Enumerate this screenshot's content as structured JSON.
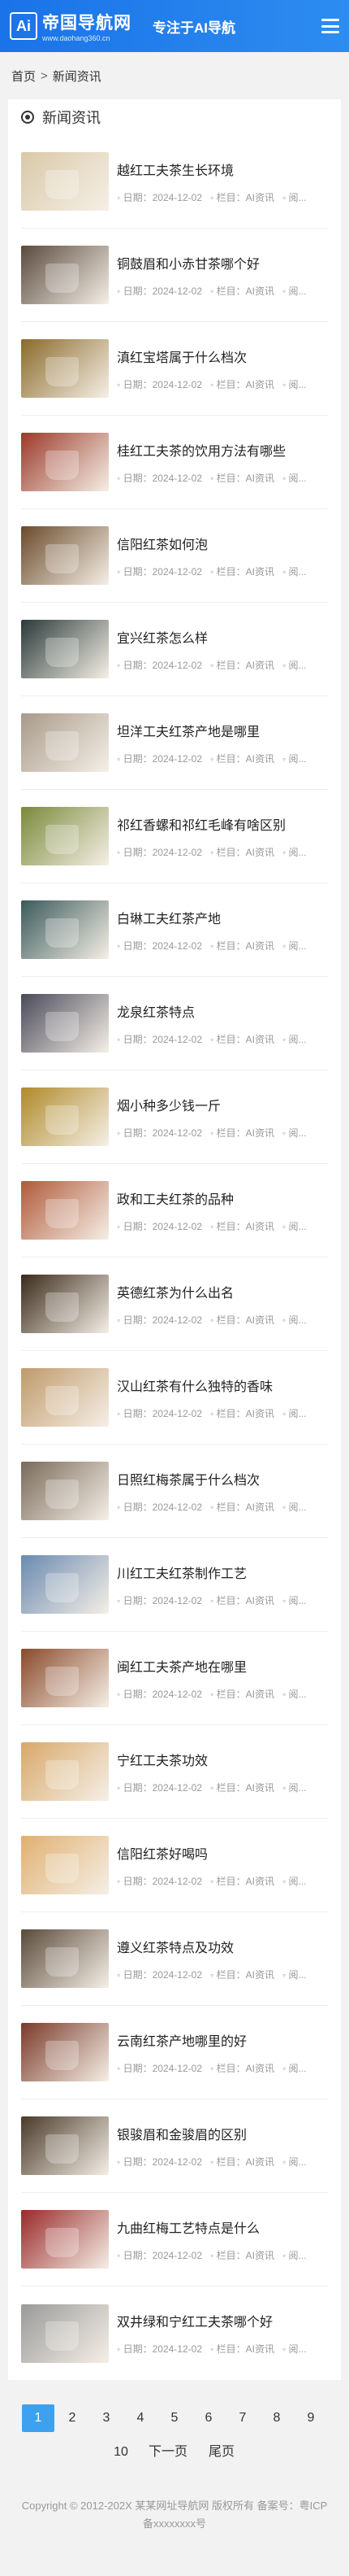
{
  "header": {
    "logo_mark": "Ai",
    "logo_title": "帝国导航网",
    "logo_domain": "www.daohang360.cn",
    "slogan": "专注于AI导航"
  },
  "breadcrumb": {
    "home": "首页",
    "sep": ">",
    "current": "新闻资讯"
  },
  "section_title": "新闻资讯",
  "meta_labels": {
    "date": "日期：",
    "column": "栏目：",
    "views": "阅..."
  },
  "articles": [
    {
      "title": "越红工夫茶生长环境",
      "date": "2024-12-02",
      "column": "AI资讯",
      "color": "#d9c9a8"
    },
    {
      "title": "铜鼓眉和小赤甘茶哪个好",
      "date": "2024-12-02",
      "column": "AI资讯",
      "color": "#5a4a3e"
    },
    {
      "title": "滇红宝塔属于什么档次",
      "date": "2024-12-02",
      "column": "AI资讯",
      "color": "#8a6a2a"
    },
    {
      "title": "桂红工夫茶的饮用方法有哪些",
      "date": "2024-12-02",
      "column": "AI资讯",
      "color": "#9b3a2a"
    },
    {
      "title": "信阳红茶如何泡",
      "date": "2024-12-02",
      "column": "AI资讯",
      "color": "#6a4a2a"
    },
    {
      "title": "宜兴红茶怎么样",
      "date": "2024-12-02",
      "column": "AI资讯",
      "color": "#2a3a3a"
    },
    {
      "title": "坦洋工夫红茶产地是哪里",
      "date": "2024-12-02",
      "column": "AI资讯",
      "color": "#a89a8a"
    },
    {
      "title": "祁红香螺和祁红毛峰有啥区别",
      "date": "2024-12-02",
      "column": "AI资讯",
      "color": "#7a8a3a"
    },
    {
      "title": "白琳工夫红茶产地",
      "date": "2024-12-02",
      "column": "AI资讯",
      "color": "#3a5a5a"
    },
    {
      "title": "龙泉红茶特点",
      "date": "2024-12-02",
      "column": "AI资讯",
      "color": "#4a4a5a"
    },
    {
      "title": "烟小种多少钱一斤",
      "date": "2024-12-02",
      "column": "AI资讯",
      "color": "#b08a2a"
    },
    {
      "title": "政和工夫红茶的品种",
      "date": "2024-12-02",
      "column": "AI资讯",
      "color": "#b05a3a"
    },
    {
      "title": "英德红茶为什么出名",
      "date": "2024-12-02",
      "column": "AI资讯",
      "color": "#3a2a1a"
    },
    {
      "title": "汉山红茶有什么独特的香味",
      "date": "2024-12-02",
      "column": "AI资讯",
      "color": "#c09a6a"
    },
    {
      "title": "日照红梅茶属于什么档次",
      "date": "2024-12-02",
      "column": "AI资讯",
      "color": "#7a6a5a"
    },
    {
      "title": "川红工夫红茶制作工艺",
      "date": "2024-12-02",
      "column": "AI资讯",
      "color": "#6a8ab0"
    },
    {
      "title": "闽红工夫茶产地在哪里",
      "date": "2024-12-02",
      "column": "AI资讯",
      "color": "#8a4a2a"
    },
    {
      "title": "宁红工夫茶功效",
      "date": "2024-12-02",
      "column": "AI资讯",
      "color": "#d8a86a"
    },
    {
      "title": "信阳红茶好喝吗",
      "date": "2024-12-02",
      "column": "AI资讯",
      "color": "#e0b070"
    },
    {
      "title": "遵义红茶特点及功效",
      "date": "2024-12-02",
      "column": "AI资讯",
      "color": "#5a4a3a"
    },
    {
      "title": "云南红茶产地哪里的好",
      "date": "2024-12-02",
      "column": "AI资讯",
      "color": "#7a3a2a"
    },
    {
      "title": "银骏眉和金骏眉的区别",
      "date": "2024-12-02",
      "column": "AI资讯",
      "color": "#4a3a2a"
    },
    {
      "title": "九曲红梅工艺特点是什么",
      "date": "2024-12-02",
      "column": "AI资讯",
      "color": "#9a2a2a"
    },
    {
      "title": "双井绿和宁红工夫茶哪个好",
      "date": "2024-12-02",
      "column": "AI资讯",
      "color": "#9a9a9a"
    }
  ],
  "pagination": {
    "pages": [
      "1",
      "2",
      "3",
      "4",
      "5",
      "6",
      "7",
      "8",
      "9",
      "10"
    ],
    "active": "1",
    "next": "下一页",
    "last": "尾页"
  },
  "footer": {
    "line1": "Copyright © 2012-202X 某某网址导航网 版权所有 备案号：粤ICP",
    "line2": "备xxxxxxxx号"
  }
}
